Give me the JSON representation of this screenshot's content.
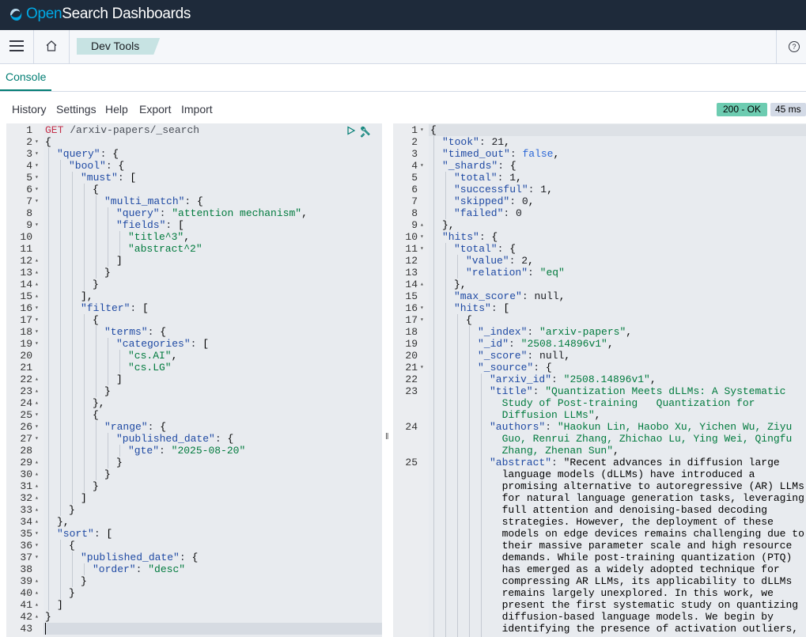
{
  "header": {
    "brand_prefix": "Open",
    "brand_suffix": "Search Dashboards"
  },
  "nav": {
    "breadcrumb": "Dev Tools",
    "help_icon": "help-icon"
  },
  "tabs": [
    {
      "label": "Console"
    }
  ],
  "menu": {
    "history": "History",
    "settings": "Settings",
    "help": "Help",
    "export": "Export",
    "import": "Import"
  },
  "status": {
    "code": "200 - OK",
    "time": "45 ms"
  },
  "request": {
    "method": "GET",
    "path": "/arxiv-papers/_search",
    "lines": [
      {
        "n": 1,
        "fold": "",
        "indent": 0,
        "html": ""
      },
      {
        "n": 2,
        "fold": "▾",
        "indent": 0,
        "text": "{"
      },
      {
        "n": 3,
        "fold": "▾",
        "indent": 1,
        "text": "\"query\": {"
      },
      {
        "n": 4,
        "fold": "▾",
        "indent": 2,
        "text": "\"bool\": {"
      },
      {
        "n": 5,
        "fold": "▾",
        "indent": 3,
        "text": "\"must\": ["
      },
      {
        "n": 6,
        "fold": "▾",
        "indent": 4,
        "text": "{"
      },
      {
        "n": 7,
        "fold": "▾",
        "indent": 5,
        "text": "\"multi_match\": {"
      },
      {
        "n": 8,
        "fold": "",
        "indent": 6,
        "text": "\"query\": \"attention mechanism\","
      },
      {
        "n": 9,
        "fold": "▾",
        "indent": 6,
        "text": "\"fields\": ["
      },
      {
        "n": 10,
        "fold": "",
        "indent": 7,
        "text": "\"title^3\","
      },
      {
        "n": 11,
        "fold": "",
        "indent": 7,
        "text": "\"abstract^2\""
      },
      {
        "n": 12,
        "fold": "▴",
        "indent": 6,
        "text": "]"
      },
      {
        "n": 13,
        "fold": "▴",
        "indent": 5,
        "text": "}"
      },
      {
        "n": 14,
        "fold": "▴",
        "indent": 4,
        "text": "}"
      },
      {
        "n": 15,
        "fold": "▴",
        "indent": 3,
        "text": "],"
      },
      {
        "n": 16,
        "fold": "▾",
        "indent": 3,
        "text": "\"filter\": ["
      },
      {
        "n": 17,
        "fold": "▾",
        "indent": 4,
        "text": "{"
      },
      {
        "n": 18,
        "fold": "▾",
        "indent": 5,
        "text": "\"terms\": {"
      },
      {
        "n": 19,
        "fold": "▾",
        "indent": 6,
        "text": "\"categories\": ["
      },
      {
        "n": 20,
        "fold": "",
        "indent": 7,
        "text": "\"cs.AI\","
      },
      {
        "n": 21,
        "fold": "",
        "indent": 7,
        "text": "\"cs.LG\""
      },
      {
        "n": 22,
        "fold": "▴",
        "indent": 6,
        "text": "]"
      },
      {
        "n": 23,
        "fold": "▴",
        "indent": 5,
        "text": "}"
      },
      {
        "n": 24,
        "fold": "▴",
        "indent": 4,
        "text": "},"
      },
      {
        "n": 25,
        "fold": "▾",
        "indent": 4,
        "text": "{"
      },
      {
        "n": 26,
        "fold": "▾",
        "indent": 5,
        "text": "\"range\": {"
      },
      {
        "n": 27,
        "fold": "▾",
        "indent": 6,
        "text": "\"published_date\": {"
      },
      {
        "n": 28,
        "fold": "",
        "indent": 7,
        "text": "\"gte\": \"2025-08-20\""
      },
      {
        "n": 29,
        "fold": "▴",
        "indent": 6,
        "text": "}"
      },
      {
        "n": 30,
        "fold": "▴",
        "indent": 5,
        "text": "}"
      },
      {
        "n": 31,
        "fold": "▴",
        "indent": 4,
        "text": "}"
      },
      {
        "n": 32,
        "fold": "▴",
        "indent": 3,
        "text": "]"
      },
      {
        "n": 33,
        "fold": "▴",
        "indent": 2,
        "text": "}"
      },
      {
        "n": 34,
        "fold": "▴",
        "indent": 1,
        "text": "},"
      },
      {
        "n": 35,
        "fold": "▾",
        "indent": 1,
        "text": "\"sort\": ["
      },
      {
        "n": 36,
        "fold": "▾",
        "indent": 2,
        "text": "{"
      },
      {
        "n": 37,
        "fold": "▾",
        "indent": 3,
        "text": "\"published_date\": {"
      },
      {
        "n": 38,
        "fold": "",
        "indent": 4,
        "text": "\"order\": \"desc\""
      },
      {
        "n": 39,
        "fold": "▴",
        "indent": 3,
        "text": "}"
      },
      {
        "n": 40,
        "fold": "▴",
        "indent": 2,
        "text": "}"
      },
      {
        "n": 41,
        "fold": "▴",
        "indent": 1,
        "text": "]"
      },
      {
        "n": 42,
        "fold": "▴",
        "indent": 0,
        "text": "}"
      },
      {
        "n": 43,
        "fold": "",
        "indent": 0,
        "text": ""
      }
    ]
  },
  "response": {
    "lines": [
      {
        "n": 1,
        "fold": "▾",
        "indent": 0,
        "rows": 1,
        "text": "{"
      },
      {
        "n": 2,
        "fold": "",
        "indent": 1,
        "rows": 1,
        "text": "\"took\": 21,"
      },
      {
        "n": 3,
        "fold": "",
        "indent": 1,
        "rows": 1,
        "text": "\"timed_out\": false,"
      },
      {
        "n": 4,
        "fold": "▾",
        "indent": 1,
        "rows": 1,
        "text": "\"_shards\": {"
      },
      {
        "n": 5,
        "fold": "",
        "indent": 2,
        "rows": 1,
        "text": "\"total\": 1,"
      },
      {
        "n": 6,
        "fold": "",
        "indent": 2,
        "rows": 1,
        "text": "\"successful\": 1,"
      },
      {
        "n": 7,
        "fold": "",
        "indent": 2,
        "rows": 1,
        "text": "\"skipped\": 0,"
      },
      {
        "n": 8,
        "fold": "",
        "indent": 2,
        "rows": 1,
        "text": "\"failed\": 0"
      },
      {
        "n": 9,
        "fold": "▴",
        "indent": 1,
        "rows": 1,
        "text": "},"
      },
      {
        "n": 10,
        "fold": "▾",
        "indent": 1,
        "rows": 1,
        "text": "\"hits\": {"
      },
      {
        "n": 11,
        "fold": "▾",
        "indent": 2,
        "rows": 1,
        "text": "\"total\": {"
      },
      {
        "n": 12,
        "fold": "",
        "indent": 3,
        "rows": 1,
        "text": "\"value\": 2,"
      },
      {
        "n": 13,
        "fold": "",
        "indent": 3,
        "rows": 1,
        "text": "\"relation\": \"eq\""
      },
      {
        "n": 14,
        "fold": "▴",
        "indent": 2,
        "rows": 1,
        "text": "},"
      },
      {
        "n": 15,
        "fold": "",
        "indent": 2,
        "rows": 1,
        "text": "\"max_score\": null,"
      },
      {
        "n": 16,
        "fold": "▾",
        "indent": 2,
        "rows": 1,
        "text": "\"hits\": ["
      },
      {
        "n": 17,
        "fold": "▾",
        "indent": 3,
        "rows": 1,
        "text": "{"
      },
      {
        "n": 18,
        "fold": "",
        "indent": 4,
        "rows": 1,
        "text": "\"_index\": \"arxiv-papers\","
      },
      {
        "n": 19,
        "fold": "",
        "indent": 4,
        "rows": 1,
        "text": "\"_id\": \"2508.14896v1\","
      },
      {
        "n": 20,
        "fold": "",
        "indent": 4,
        "rows": 1,
        "text": "\"_score\": null,"
      },
      {
        "n": 21,
        "fold": "▾",
        "indent": 4,
        "rows": 1,
        "text": "\"_source\": {"
      },
      {
        "n": 22,
        "fold": "",
        "indent": 5,
        "rows": 1,
        "text": "\"arxiv_id\": \"2508.14896v1\","
      },
      {
        "n": 23,
        "fold": "",
        "indent": 5,
        "rows": 3,
        "text": "\"title\": \"Quantization Meets dLLMs: A Systematic\n  Study of Post-training   Quantization for\n  Diffusion LLMs\","
      },
      {
        "n": 24,
        "fold": "",
        "indent": 5,
        "rows": 3,
        "text": "\"authors\": \"Haokun Lin, Haobo Xu, Yichen Wu, Ziyu\n  Guo, Renrui Zhang, Zhichao Lu, Ying Wei, Qingfu\n  Zhang, Zhenan Sun\","
      },
      {
        "n": 25,
        "fold": "",
        "indent": 5,
        "rows": 16,
        "text": "\"abstract\": \"Recent advances in diffusion large\n  language models (dLLMs) have introduced a\n  promising alternative to autoregressive (AR) LLMs\n  for natural language generation tasks, leveraging\n  full attention and denoising-based decoding\n  strategies. However, the deployment of these\n  models on edge devices remains challenging due to\n  their massive parameter scale and high resource\n  demands. While post-training quantization (PTQ)\n  has emerged as a widely adopted technique for\n  compressing AR LLMs, its applicability to dLLMs\n  remains largely unexplored. In this work, we\n  present the first systematic study on quantizing\n  diffusion-based language models. We begin by\n  identifying the presence of activation outliers,"
      }
    ]
  }
}
